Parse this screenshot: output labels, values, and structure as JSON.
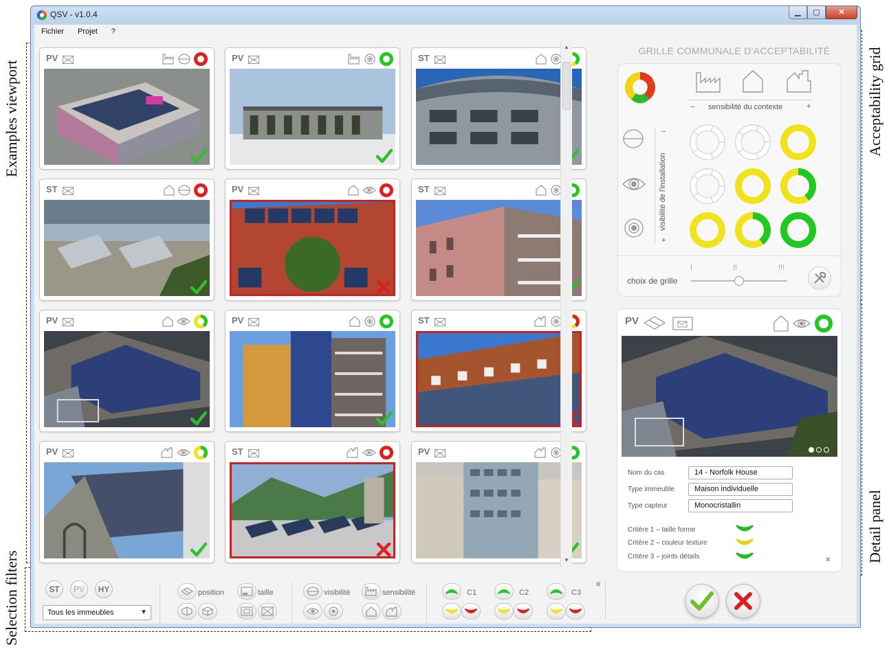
{
  "annotations": {
    "examples_viewport": "Examples viewport",
    "selection_filters": "Selection filters",
    "acceptability_grid": "Acceptability grid",
    "detail_panel": "Detail panel"
  },
  "window": {
    "title": "QSV - v1.0.4",
    "menu": [
      "Fichier",
      "Projet",
      "?"
    ]
  },
  "cards": [
    {
      "type": "PV",
      "context": "industrial",
      "visibility": "hidden",
      "rating": "red",
      "result": "ok",
      "scene": "industrial-roof"
    },
    {
      "type": "PV",
      "context": "industrial",
      "visibility": "partly",
      "rating": "green",
      "result": "ok",
      "scene": "flat-building-snow"
    },
    {
      "type": "ST",
      "context": "house",
      "visibility": "partly",
      "rating": "yellow-green",
      "result": "ok",
      "scene": "curved-facade"
    },
    {
      "type": "ST",
      "context": "house",
      "visibility": "hidden",
      "rating": "red",
      "result": "ok",
      "scene": "flat-roof-lake"
    },
    {
      "type": "PV",
      "context": "house",
      "visibility": "visible",
      "rating": "red",
      "result": "ko",
      "scene": "tiled-roof-tree"
    },
    {
      "type": "ST",
      "context": "house",
      "visibility": "partly",
      "rating": "green",
      "result": "ok",
      "scene": "pink-balcony"
    },
    {
      "type": "PV",
      "context": "house",
      "visibility": "visible",
      "rating": "yellow-green",
      "result": "ok",
      "scene": "norfolk-roof"
    },
    {
      "type": "PV",
      "context": "house",
      "visibility": "partly",
      "rating": "green",
      "result": "ok",
      "scene": "tower-facade"
    },
    {
      "type": "ST",
      "context": "heritage",
      "visibility": "partly",
      "rating": "yellow-red",
      "result": "ko",
      "scene": "mansard-facade"
    },
    {
      "type": "PV",
      "context": "heritage",
      "visibility": "visible",
      "rating": "yellow-green",
      "result": "ok",
      "scene": "church-roof"
    },
    {
      "type": "ST",
      "context": "heritage",
      "visibility": "visible",
      "rating": "red",
      "result": "ko",
      "scene": "mountain-collectors"
    },
    {
      "type": "PV",
      "context": "heritage",
      "visibility": "partly",
      "rating": "green",
      "result": "ok",
      "scene": "glass-tower"
    }
  ],
  "grid": {
    "title": "GRILLE COMMUNALE D'ACCEPTABILITÉ",
    "context_axis": "sensibilité du contexte",
    "minus": "−",
    "plus": "+",
    "visibility_axis": "visibilité de l'installation",
    "cells": [
      [
        "empty",
        "empty",
        "yellow"
      ],
      [
        "empty",
        "yellow",
        "yellow-green"
      ],
      [
        "yellow",
        "yellow-green",
        "green"
      ]
    ],
    "choice_label": "choix de grille",
    "levels": [
      "!",
      "!!",
      "!!!"
    ],
    "slider_level": 0.5
  },
  "detail": {
    "type": "PV",
    "image_dots": 3,
    "fields": [
      {
        "label": "Nom du cas",
        "value": "14 - Norfolk House"
      },
      {
        "label": "Type immeuble",
        "value": "Maison individuelle"
      },
      {
        "label": "Type capteur",
        "value": "Monocristallin"
      }
    ],
    "criteria": [
      {
        "label": "Critère 1 – taille  forme",
        "color": "#22bb22"
      },
      {
        "label": "Critère 2 – couleur texture",
        "color": "#e6d21a"
      },
      {
        "label": "Critère 3 – joints  détails",
        "color": "#22bb22"
      }
    ],
    "close": "✖"
  },
  "filters": {
    "types": [
      "ST",
      "PV",
      "HY"
    ],
    "building_select": "Tous les immeubles",
    "position": "position",
    "taille": "taille",
    "visibilite": "visibilité",
    "sensibilite": "sensibilité",
    "criteria": [
      "C1",
      "C2",
      "C3"
    ],
    "close": "✖"
  },
  "colors": {
    "red": "#dd1f1f",
    "green": "#22c822",
    "yellow": "#f0e21c",
    "check": "#2fbf2f"
  }
}
